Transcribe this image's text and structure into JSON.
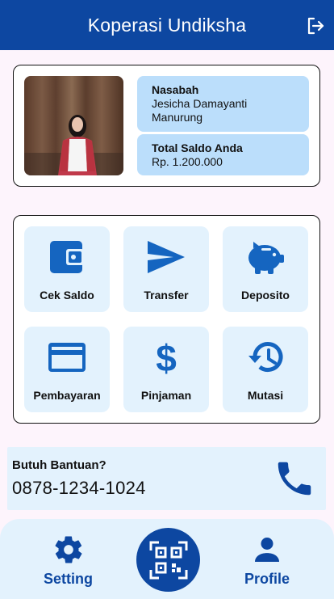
{
  "appbar": {
    "title": "Koperasi Undiksha",
    "logout_icon": "logout-icon"
  },
  "profile": {
    "nasabah_label": "Nasabah",
    "nasabah_name": "Jesicha Damayanti Manurung",
    "saldo_label": "Total Saldo Anda",
    "saldo_value": "Rp. 1.200.000"
  },
  "menu": [
    {
      "label": "Cek Saldo",
      "icon": "wallet-icon"
    },
    {
      "label": "Transfer",
      "icon": "send-icon"
    },
    {
      "label": "Deposito",
      "icon": "piggy-bank-icon"
    },
    {
      "label": "Pembayaran",
      "icon": "credit-card-icon"
    },
    {
      "label": "Pinjaman",
      "icon": "dollar-icon"
    },
    {
      "label": "Mutasi",
      "icon": "history-icon"
    }
  ],
  "help": {
    "title": "Butuh Bantuan?",
    "phone": "0878-1234-1024",
    "icon": "phone-icon"
  },
  "bottom_nav": {
    "setting_label": "Setting",
    "profile_label": "Profile",
    "qr_icon": "qr-code-scan-icon"
  },
  "colors": {
    "primary": "#0d47a1",
    "icon_blue": "#1565c0",
    "tile": "#e3f2fd",
    "info_box": "#bbdefb"
  }
}
